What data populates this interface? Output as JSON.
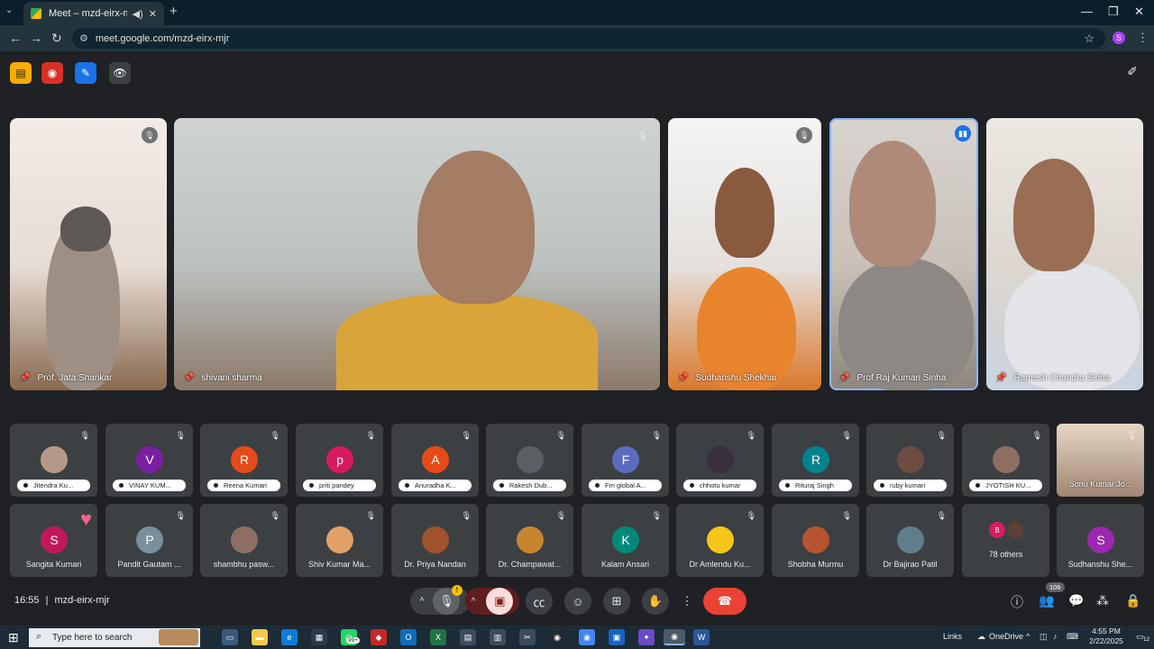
{
  "browser": {
    "tab_title": "Meet – mzd-eirx-mjr",
    "url": "meet.google.com/mzd-eirx-mjr",
    "profile_initial": "S"
  },
  "meet": {
    "featured": [
      {
        "name": "Prof. Jata Shankar",
        "muted": true
      },
      {
        "name": "shivani sharma",
        "muted": true
      },
      {
        "name": "Sudhanshu Shekhar",
        "muted": true
      },
      {
        "name": "Prof Raj Kumari Sinha",
        "muted": false,
        "speaking": true
      },
      {
        "name": "Ramesh Chandra Sinha",
        "muted": true
      }
    ],
    "grid_row1": [
      {
        "name": "Jitendra Ku...",
        "avatar": "photo"
      },
      {
        "name": "VINAY KUM...",
        "initial": "V",
        "color": "#7b1fa2"
      },
      {
        "name": "Reena Kumari",
        "initial": "R",
        "color": "#e64a19"
      },
      {
        "name": "priti pandey",
        "initial": "p",
        "color": "#d81b60"
      },
      {
        "name": "Anuradha K...",
        "initial": "A",
        "color": "#e64a19"
      },
      {
        "name": "Rakesh Dub...",
        "avatar": "photo"
      },
      {
        "name": "Fm global A...",
        "initial": "F",
        "color": "#5c6bc0"
      },
      {
        "name": "chhotu kumar",
        "avatar": "photo"
      },
      {
        "name": "Rituraj Singh",
        "initial": "R",
        "color": "#00838f"
      },
      {
        "name": "ruby kumari",
        "avatar": "photo"
      },
      {
        "name": "JYOTISH KU...",
        "avatar": "photo"
      },
      {
        "name": "Sonu Kumar Jo...",
        "avatar": "video"
      }
    ],
    "grid_row2": [
      {
        "name": "Sangita Kumari",
        "initial": "S",
        "color": "#c2185b"
      },
      {
        "name": "Pandit Gautam ...",
        "initial": "P",
        "color": "#78909c"
      },
      {
        "name": "shambhu pasw...",
        "avatar": "photo"
      },
      {
        "name": "Shiv Kumar Ma...",
        "avatar": "photo"
      },
      {
        "name": "Dr. Priya Nandan",
        "avatar": "photo"
      },
      {
        "name": "Dr. Champawat...",
        "avatar": "photo"
      },
      {
        "name": "Kalam Ansari",
        "initial": "K",
        "color": "#00897b"
      },
      {
        "name": "Dr Amlendu Ku...",
        "avatar": "photo"
      },
      {
        "name": "Shobha Murmu",
        "avatar": "photo"
      },
      {
        "name": "Dr Bajirao Patil",
        "avatar": "photo"
      },
      {
        "name": "78 others",
        "initial": "B",
        "color": "#d81b60"
      },
      {
        "name": "Sudhanshu She...",
        "initial": "S",
        "color": "#9c27b0"
      }
    ],
    "time": "16:55",
    "meeting_code": "mzd-eirx-mjr",
    "participant_count": "106",
    "mic_alert": "!"
  },
  "taskbar": {
    "search_placeholder": "Type here to search",
    "whatsapp_badge": "99+",
    "links_label": "Links",
    "onedrive_label": "OneDrive",
    "time": "4:55 PM",
    "date": "2/22/2025",
    "notification_count": "12"
  },
  "colors": {
    "accent_blue": "#1a73e8",
    "end_call_red": "#ea4335",
    "tile_bg": "#3c4043"
  }
}
